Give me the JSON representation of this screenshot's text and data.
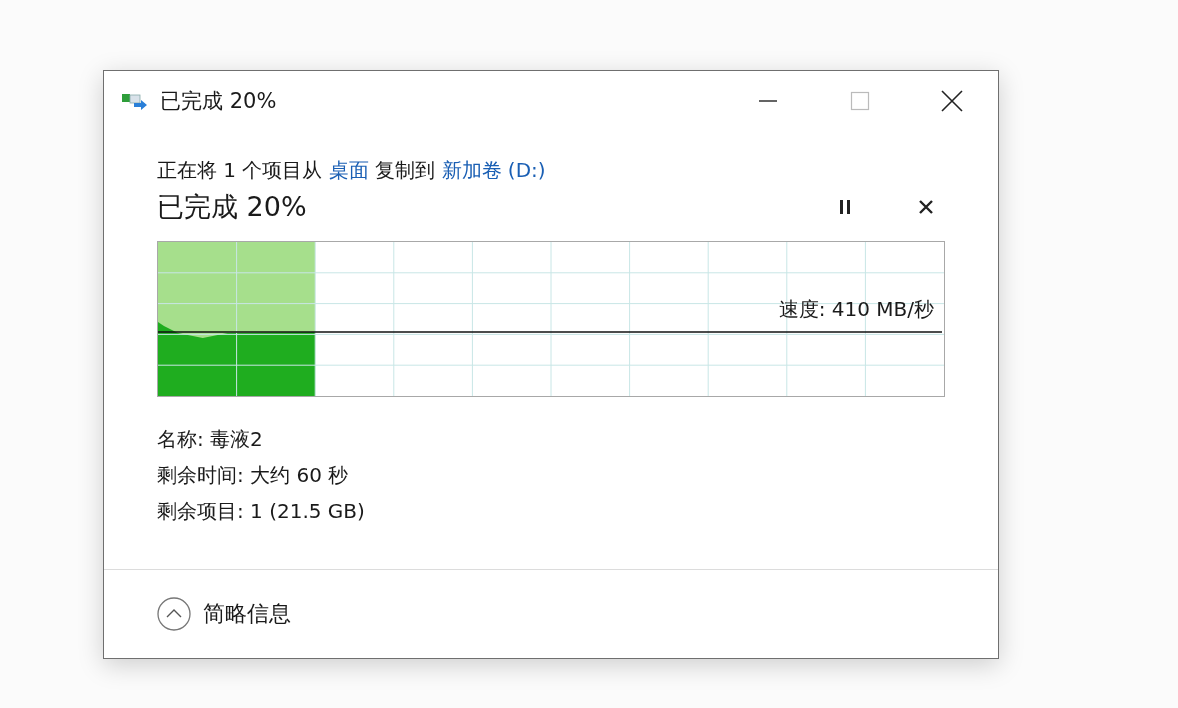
{
  "window": {
    "title": "已完成 20%"
  },
  "copy_line": {
    "prefix": "正在将 1 个项目从",
    "source": "桌面",
    "middle": "复制到",
    "destination": "新加卷 (D:)"
  },
  "progress": {
    "heading": "已完成 20%",
    "level": 0.2,
    "speed": "速度: 410 MB/秒"
  },
  "details": [
    "名称: 毒液2",
    "剩余时间: 大约 60 秒",
    "剩余项目: 1 (21.5 GB)"
  ],
  "footer": {
    "label": "简略信息",
    "expanded": true
  }
}
